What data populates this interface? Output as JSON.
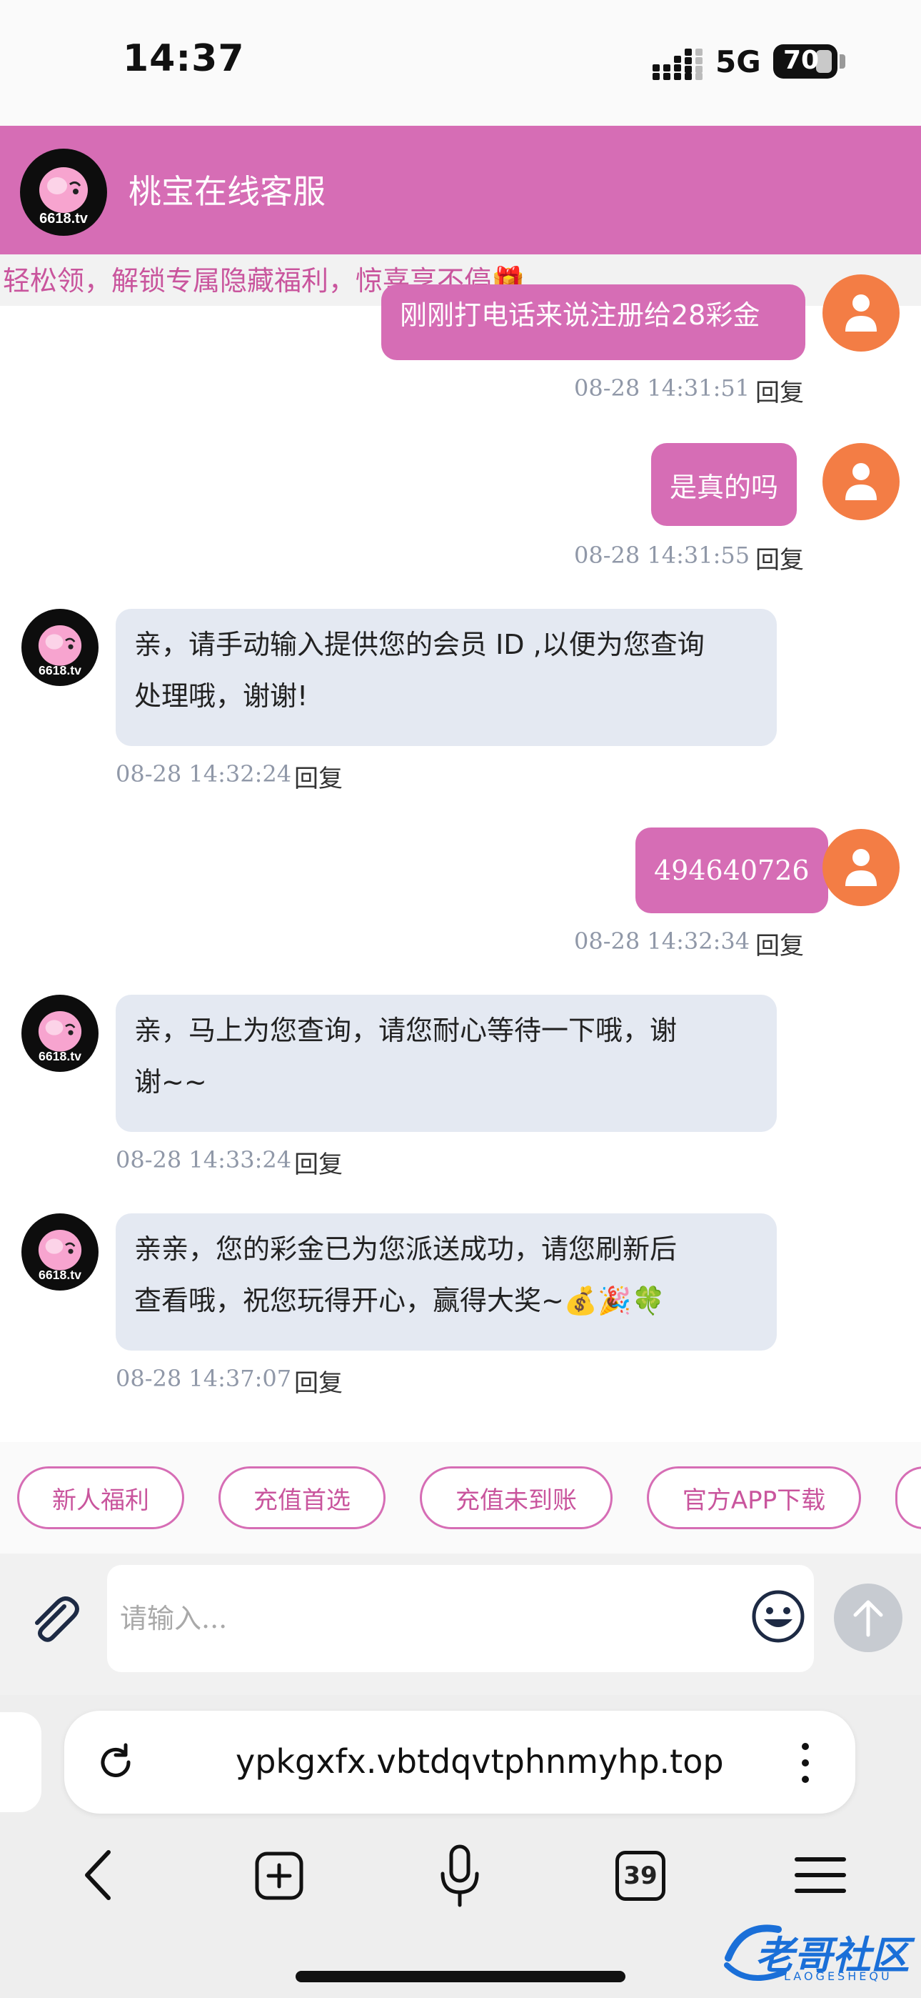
{
  "status_bar": {
    "time": "14:37",
    "network": "5G",
    "battery": "70"
  },
  "header": {
    "title": "桃宝在线客服",
    "avatar_text": "6618.tv"
  },
  "marquee": {
    "text": "轻松领，解锁专属隐藏福利，惊喜享不停🎁"
  },
  "messages": [
    {
      "from": "user",
      "text": "刚刚打电话来说注册给28彩金",
      "time": "08-28 14:31:51",
      "reply": "回复"
    },
    {
      "from": "user",
      "text": "是真的吗",
      "time": "08-28 14:31:55",
      "reply": "回复"
    },
    {
      "from": "agent",
      "line1": "亲，请手动输入提供您的会员 ID ,以便为您查询",
      "line2": "处理哦，谢谢!",
      "time": "08-28 14:32:24",
      "reply": "回复"
    },
    {
      "from": "user",
      "text": "494640726",
      "time": "08-28 14:32:34",
      "reply": "回复"
    },
    {
      "from": "agent",
      "line1": "亲，马上为您查询，请您耐心等待一下哦，谢",
      "line2": "谢~~",
      "time": "08-28 14:33:24",
      "reply": "回复"
    },
    {
      "from": "agent",
      "line1": "亲亲，您的彩金已为您派送成功，请您刷新后",
      "line2": "查看哦，祝您玩得开心，赢得大奖~💰🎉🍀",
      "time": "08-28 14:37:07",
      "reply": "回复"
    }
  ],
  "quick_buttons": [
    "新人福利",
    "充值首选",
    "充值未到账",
    "官方APP下载"
  ],
  "input": {
    "placeholder": "请输入..."
  },
  "browser": {
    "url": "ypkgxfx.vbtdqvtphnmyhp.top",
    "tab_count": "39"
  },
  "watermark": {
    "text": "老哥社区",
    "sub": "LAOGESHEQU"
  },
  "colors": {
    "brand": "#d66db5",
    "user_avatar": "#f37d45",
    "agent_bubble": "#e4e9f2"
  }
}
